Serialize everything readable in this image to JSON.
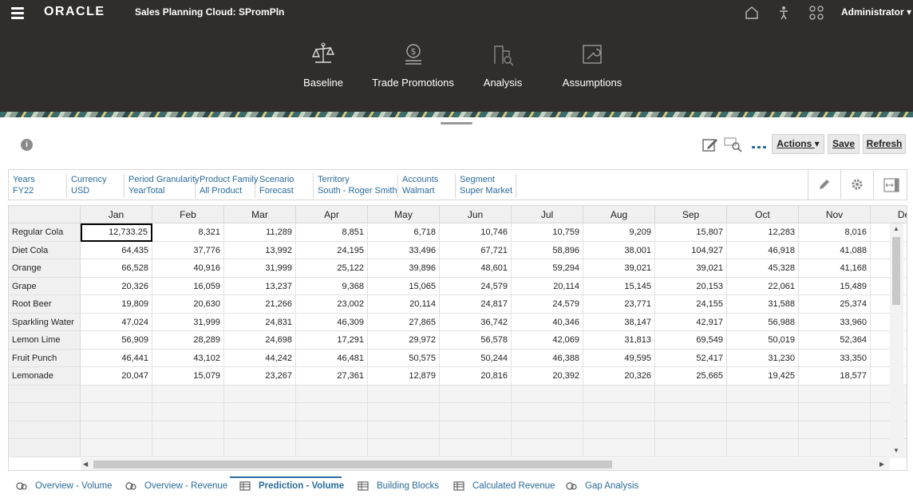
{
  "header": {
    "brand": "ORACLE",
    "app_title": "Sales Planning Cloud: SPromPln",
    "user": "Administrator",
    "nav": [
      {
        "label": "Baseline",
        "icon": "scale-icon"
      },
      {
        "label": "Trade Promotions",
        "icon": "dollar-stack-icon"
      },
      {
        "label": "Analysis",
        "icon": "building-search-icon"
      },
      {
        "label": "Assumptions",
        "icon": "wrench-icon"
      }
    ]
  },
  "toolbar": {
    "info": "i",
    "actions_label": "Actions",
    "save_label": "Save",
    "refresh_label": "Refresh"
  },
  "pov": [
    {
      "key": "Years",
      "value": "FY22"
    },
    {
      "key": "Currency",
      "value": "USD"
    },
    {
      "key": "Period Granularity",
      "value": "YearTotal"
    },
    {
      "key": "Product Family",
      "value": "All Product"
    },
    {
      "key": "Scenario",
      "value": "Forecast"
    },
    {
      "key": "Territory",
      "value": "South - Roger Smith"
    },
    {
      "key": "Accounts",
      "value": "Walmart"
    },
    {
      "key": "Segment",
      "value": "Super Market"
    }
  ],
  "grid": {
    "columns": [
      "Jan",
      "Feb",
      "Mar",
      "Apr",
      "May",
      "Jun",
      "Jul",
      "Aug",
      "Sep",
      "Oct",
      "Nov",
      "Dec"
    ],
    "rows": [
      {
        "label": "Regular Cola",
        "values": [
          "12,733.25",
          "8,321",
          "11,289",
          "8,851",
          "6,718",
          "10,746",
          "10,759",
          "9,209",
          "15,807",
          "12,283",
          "8,016"
        ]
      },
      {
        "label": "Diet Cola",
        "values": [
          "64,435",
          "37,776",
          "13,992",
          "24,195",
          "33,496",
          "67,721",
          "58,896",
          "38,001",
          "104,927",
          "46,918",
          "41,088"
        ]
      },
      {
        "label": "Orange",
        "values": [
          "66,528",
          "40,916",
          "31,999",
          "25,122",
          "39,896",
          "48,601",
          "59,294",
          "39,021",
          "39,021",
          "45,328",
          "41,168"
        ]
      },
      {
        "label": "Grape",
        "values": [
          "20,326",
          "16,059",
          "13,237",
          "9,368",
          "15,065",
          "24,579",
          "20,114",
          "15,145",
          "20,153",
          "22,061",
          "15,489"
        ]
      },
      {
        "label": "Root Beer",
        "values": [
          "19,809",
          "20,630",
          "21,266",
          "23,002",
          "20,114",
          "24,817",
          "24,579",
          "23,771",
          "24,155",
          "31,588",
          "25,374"
        ]
      },
      {
        "label": "Sparkling Water",
        "values": [
          "47,024",
          "31,999",
          "24,831",
          "46,309",
          "27,865",
          "36,742",
          "40,346",
          "38,147",
          "42,917",
          "56,988",
          "33,960"
        ]
      },
      {
        "label": "Lemon Lime",
        "values": [
          "56,909",
          "28,289",
          "24,698",
          "17,291",
          "29,972",
          "56,578",
          "42,069",
          "31,813",
          "69,549",
          "50,019",
          "52,364"
        ]
      },
      {
        "label": "Fruit Punch",
        "values": [
          "46,441",
          "43,102",
          "44,242",
          "46,481",
          "50,575",
          "50,244",
          "46,388",
          "49,595",
          "52,417",
          "31,230",
          "33,350"
        ]
      },
      {
        "label": "Lemonade",
        "values": [
          "20,047",
          "15,079",
          "23,267",
          "27,361",
          "12,879",
          "20,816",
          "20,392",
          "20,326",
          "25,665",
          "19,425",
          "18,577"
        ]
      }
    ]
  },
  "tabs": [
    {
      "label": "Overview - Volume",
      "active": false
    },
    {
      "label": "Overview - Revenue",
      "active": false
    },
    {
      "label": "Prediction - Volume",
      "active": true
    },
    {
      "label": "Building Blocks",
      "active": false
    },
    {
      "label": "Calculated Revenue",
      "active": false
    },
    {
      "label": "Gap Analysis",
      "active": false
    }
  ],
  "colors": {
    "header_bg": "#312d2a",
    "link": "#2a6b9c"
  }
}
